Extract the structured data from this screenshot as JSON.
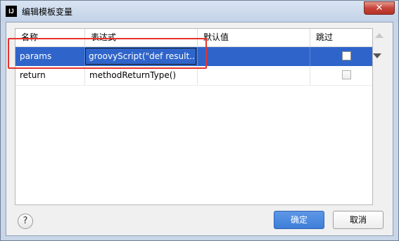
{
  "window": {
    "title": "编辑模板变量",
    "app_icon_text": "IJ",
    "close_symbol": "✕"
  },
  "table": {
    "columns": [
      "名称",
      "表达式",
      "默认值",
      "跳过"
    ],
    "rows": [
      {
        "name": "params",
        "expression": "groovyScript(\"def result...",
        "default": "",
        "skip": false,
        "selected": true
      },
      {
        "name": "return",
        "expression": "methodReturnType()",
        "default": "",
        "skip": false,
        "selected": false
      }
    ]
  },
  "buttons": {
    "help": "?",
    "ok": "确定",
    "cancel": "取消"
  },
  "colors": {
    "selection": "#2f65ca",
    "highlight": "#e8322d",
    "primary_button": "#3e7ed8"
  }
}
